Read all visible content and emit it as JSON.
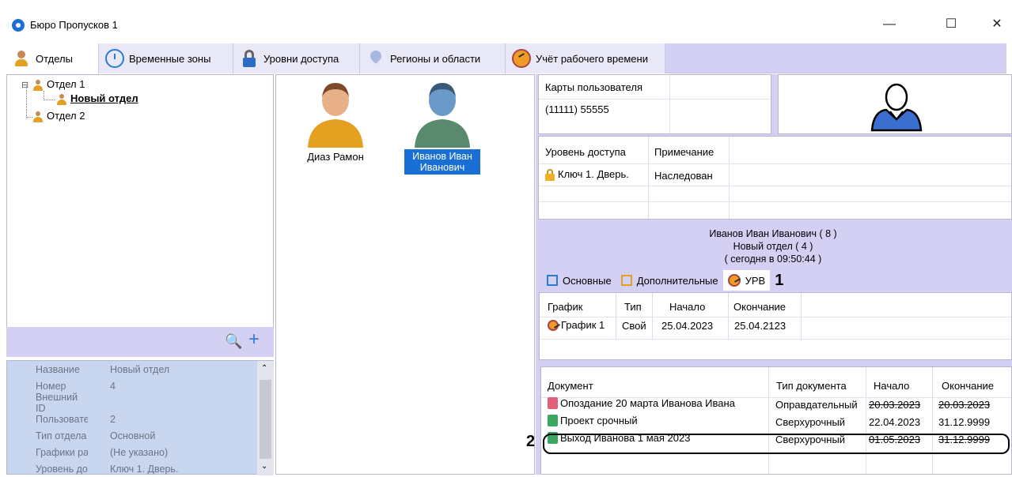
{
  "window": {
    "title": "Бюро Пропусков 1",
    "minimize": "—",
    "maximize": "☐",
    "close": "✕"
  },
  "tabs": [
    {
      "label": "Отделы",
      "icon": "person-icon"
    },
    {
      "label": "Временные зоны",
      "icon": "clock-icon"
    },
    {
      "label": "Уровни доступа",
      "icon": "lock-icon"
    },
    {
      "label": "Регионы и области",
      "icon": "region-icon"
    },
    {
      "label": "Учёт рабочего времени",
      "icon": "gauge-icon"
    }
  ],
  "tree": {
    "root1": "Отдел 1",
    "child": "Новый отдел",
    "root2": "Отдел 2",
    "expander": "⊟"
  },
  "search_icon": "🔍",
  "add_icon": "+",
  "props": [
    {
      "k": "Название",
      "v": "Новый отдел"
    },
    {
      "k": "Номер",
      "v": "4"
    },
    {
      "k": "Внешний ID",
      "v": ""
    },
    {
      "k": "Пользовател",
      "v": "2"
    },
    {
      "k": "Тип отдела",
      "v": "Основной"
    },
    {
      "k": "Графики раб",
      "v": "(Не указано)"
    },
    {
      "k": "Уровень дос",
      "v": "Ключ 1. Дверь."
    }
  ],
  "users": [
    {
      "name": "Диаз Рамон"
    },
    {
      "name": "Иванов Иван Иванович"
    }
  ],
  "cards": {
    "header": "Карты пользователя",
    "value": "(11111) 55555"
  },
  "access": {
    "h1": "Уровень доступа",
    "h2": "Примечание",
    "level": "Ключ 1. Дверь.",
    "note": "Наследован"
  },
  "info": {
    "line1": "Иванов Иван Иванович ( 8 )",
    "line2": "Новый отдел ( 4 )",
    "line3": "( сегодня в 09:50:44 )"
  },
  "subtabs": [
    {
      "label": "Основные"
    },
    {
      "label": "Дополнительные"
    },
    {
      "label": "УРВ"
    }
  ],
  "callout1": "1",
  "callout2": "2",
  "schedule": {
    "headers": [
      "График",
      "Тип",
      "Начало",
      "Окончание"
    ],
    "row": [
      "График 1",
      "Свой",
      "25.04.2023",
      "25.04.2123"
    ]
  },
  "docs": {
    "headers": [
      "Документ",
      "Тип документа",
      "Начало",
      "Окончание"
    ],
    "rows": [
      {
        "name": "Опоздание 20 марта Иванова Ивана",
        "type": "Оправдательный",
        "start": "20.03.2023",
        "end": "20.03.2023",
        "color": "#e0607a",
        "strike_start": true,
        "strike_end": true
      },
      {
        "name": "Проект срочный",
        "type": "Сверхурочный",
        "start": "22.04.2023",
        "end": "31.12.9999",
        "color": "#3aa860",
        "strike_start": false,
        "strike_end": false
      },
      {
        "name": "Выход Иванова 1 мая 2023",
        "type": "Сверхурочный",
        "start": "01.05.2023",
        "end": "31.12.9999",
        "color": "#3aa860",
        "strike_start": true,
        "strike_end": true
      }
    ]
  }
}
